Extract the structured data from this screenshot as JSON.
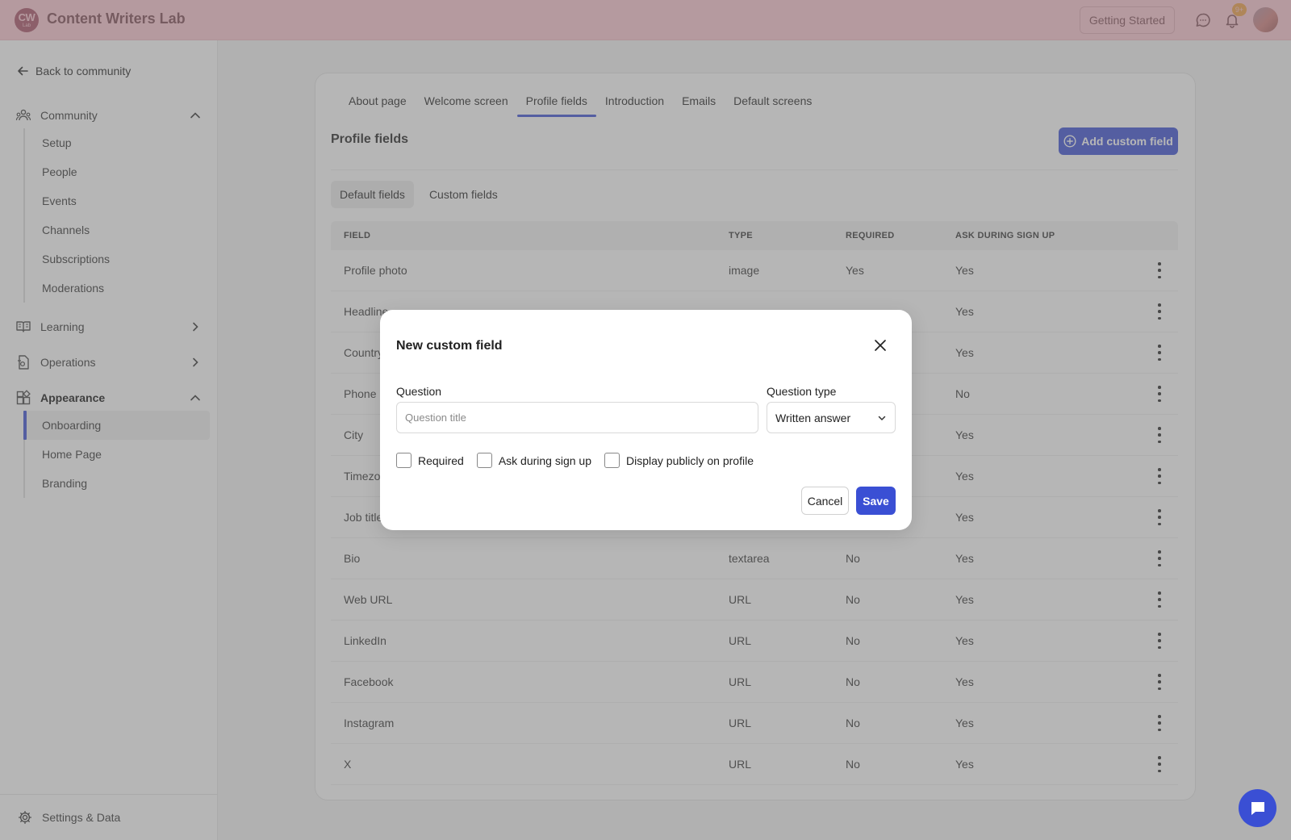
{
  "app": {
    "logo_text": "CW",
    "logo_subtext": "Lab",
    "name": "Content Writers Lab"
  },
  "topbar": {
    "getting_started": "Getting Started",
    "notification_count": "9+",
    "icons": [
      "chat-bubble-icon",
      "bell-icon",
      "avatar"
    ]
  },
  "sidebar": {
    "back_label": "Back to community",
    "groups": [
      {
        "label": "Community",
        "icon": "community-icon",
        "expanded": true,
        "items": [
          "Setup",
          "People",
          "Events",
          "Channels",
          "Subscriptions",
          "Moderations"
        ]
      },
      {
        "label": "Learning",
        "icon": "book-icon",
        "expanded": false
      },
      {
        "label": "Operations",
        "icon": "operations-icon",
        "expanded": false
      },
      {
        "label": "Appearance",
        "icon": "appearance-icon",
        "expanded": true,
        "items": [
          "Onboarding",
          "Home Page",
          "Branding"
        ],
        "active_item": "Onboarding"
      }
    ],
    "settings_label": "Settings & Data"
  },
  "main": {
    "tabs": [
      "About page",
      "Welcome screen",
      "Profile fields",
      "Introduction",
      "Emails",
      "Default screens"
    ],
    "active_tab": "Profile fields",
    "section_title": "Profile fields",
    "add_button": "Add custom field",
    "subtabs": [
      "Default fields",
      "Custom fields"
    ],
    "active_subtab": "Default fields",
    "table": {
      "headers": [
        "FIELD",
        "TYPE",
        "REQUIRED",
        "ASK DURING SIGN UP"
      ],
      "rows": [
        {
          "field": "Profile photo",
          "type": "image",
          "required": "Yes",
          "ask": "Yes"
        },
        {
          "field": "Headline",
          "type": "",
          "required": "",
          "ask": "Yes"
        },
        {
          "field": "Country",
          "type": "",
          "required": "",
          "ask": "Yes"
        },
        {
          "field": "Phone",
          "type": "",
          "required": "",
          "ask": "No"
        },
        {
          "field": "City",
          "type": "",
          "required": "",
          "ask": "Yes"
        },
        {
          "field": "Timezone",
          "type": "",
          "required": "",
          "ask": "Yes"
        },
        {
          "field": "Job title",
          "type": "",
          "required": "",
          "ask": "Yes"
        },
        {
          "field": "Bio",
          "type": "textarea",
          "required": "No",
          "ask": "Yes"
        },
        {
          "field": "Web URL",
          "type": "URL",
          "required": "No",
          "ask": "Yes"
        },
        {
          "field": "LinkedIn",
          "type": "URL",
          "required": "No",
          "ask": "Yes"
        },
        {
          "field": "Facebook",
          "type": "URL",
          "required": "No",
          "ask": "Yes"
        },
        {
          "field": "Instagram",
          "type": "URL",
          "required": "No",
          "ask": "Yes"
        },
        {
          "field": "X",
          "type": "URL",
          "required": "No",
          "ask": "Yes"
        }
      ]
    }
  },
  "modal": {
    "title": "New custom field",
    "question_label": "Question",
    "question_placeholder": "Question title",
    "question_value": "",
    "type_label": "Question type",
    "type_value": "Written answer",
    "checkboxes": [
      {
        "label": "Required",
        "checked": false
      },
      {
        "label": "Ask during sign up",
        "checked": false
      },
      {
        "label": "Display publicly on profile",
        "checked": false
      }
    ],
    "cancel": "Cancel",
    "save": "Save"
  },
  "colors": {
    "accent": "#3a4fd4",
    "logo_bg": "#6b2a3f",
    "badge": "#e8b800"
  }
}
